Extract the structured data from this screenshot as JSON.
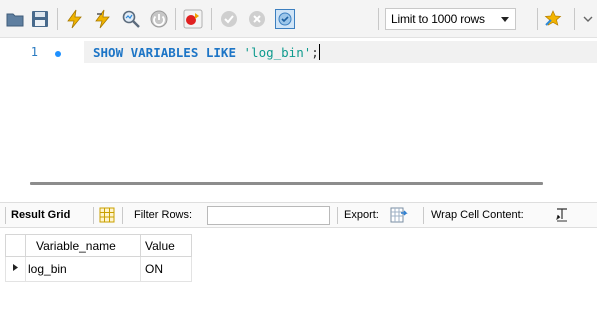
{
  "toolbar": {
    "buttons": [
      {
        "name": "open-folder-icon"
      },
      {
        "name": "save-icon"
      },
      {
        "name": "execute-icon"
      },
      {
        "name": "execute-current-icon"
      },
      {
        "name": "explain-icon"
      },
      {
        "name": "stop-icon"
      },
      {
        "name": "toggle-error-continue-icon"
      },
      {
        "name": "commit-icon"
      },
      {
        "name": "rollback-icon"
      },
      {
        "name": "autocommit-icon"
      },
      {
        "name": "beautify-icon"
      }
    ],
    "limit_label": "Limit to 1000 rows"
  },
  "editor": {
    "line_number": "1",
    "code": {
      "keywords": "SHOW VARIABLES LIKE",
      "string": "'log_bin'",
      "terminator": ";"
    }
  },
  "result_toolbar": {
    "result_grid_label": "Result Grid",
    "filter_rows_label": "Filter Rows:",
    "filter_value": "",
    "export_label": "Export:",
    "wrap_label": "Wrap Cell Content:"
  },
  "grid": {
    "columns": [
      "Variable_name",
      "Value"
    ],
    "rows": [
      [
        "log_bin",
        "ON"
      ]
    ]
  },
  "colors": {
    "keyword": "#1d75c6",
    "string": "#0f9b8e",
    "line_number": "#2a7bc1"
  }
}
